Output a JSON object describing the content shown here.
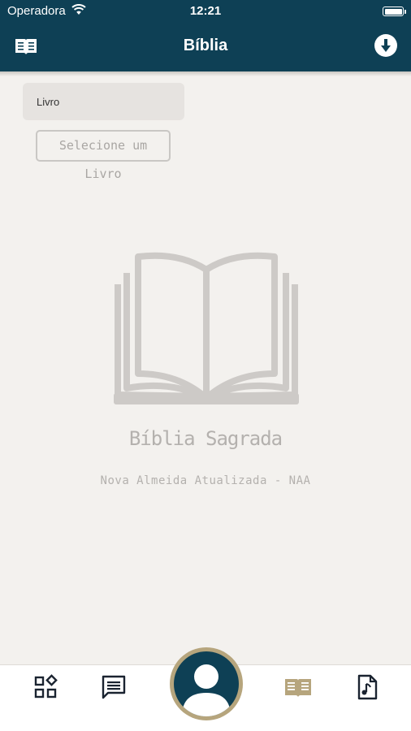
{
  "status_bar": {
    "carrier": "Operadora",
    "time": "12:21"
  },
  "header": {
    "title": "Bíblia"
  },
  "book_selector": {
    "label": "Livro",
    "button_label": "Selecione um Livro"
  },
  "empty_state": {
    "title": "Bíblia Sagrada",
    "subtitle": "Nova Almeida Atualizada - NAA"
  },
  "tab_bar": {
    "active_tab": "biblia",
    "items": [
      {
        "icon": "apps-grid-icon"
      },
      {
        "icon": "chat-icon"
      },
      {
        "icon": "profile-avatar-icon"
      },
      {
        "icon": "bible-book-icon"
      },
      {
        "icon": "music-file-icon"
      }
    ]
  },
  "colors": {
    "header_bg": "#0e4055",
    "accent_gold": "#b6a57d",
    "background": "#f3f1ee",
    "muted_text": "#b4b1ae"
  }
}
